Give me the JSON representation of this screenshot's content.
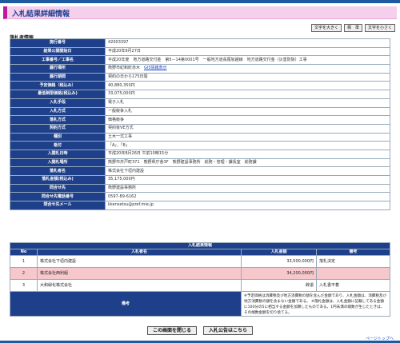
{
  "page": {
    "title": "入札結果詳細情報"
  },
  "font_size_buttons": {
    "large": "文字を大きく",
    "standard": "標　準",
    "small": "文字を小さく"
  },
  "section_label": "落札者情報",
  "info_rows": [
    {
      "label": "施行番号",
      "value": "42003397"
    },
    {
      "label": "結果公開開始日",
      "value": "平成20年9月27日"
    },
    {
      "label": "工事番号／工事名",
      "value": "平成20年度　地方道路交付金　第5－14第0001号　一般地方道長尾坂越線　地方道路交付金（災害防除）工事"
    },
    {
      "label": "履行場所",
      "value": "熊野市紀和町赤木",
      "link": "GIS情報表示"
    },
    {
      "label": "履行期間",
      "value": "契約の日から175日間"
    },
    {
      "label": "予定価格（税込み）",
      "value": "40,880,350円"
    },
    {
      "label": "最低制限価格(税込み)",
      "value": "33,075,000円"
    },
    {
      "label": "入札手段",
      "value": "電子入札"
    },
    {
      "label": "入札方式",
      "value": "一般競争入札"
    },
    {
      "label": "落札方式",
      "value": "価格競争"
    },
    {
      "label": "契約方式",
      "value": "契約後VE方式"
    },
    {
      "label": "種別",
      "value": "土木一式工事"
    },
    {
      "label": "格付",
      "value": "「A」、「B」"
    },
    {
      "label": "入開札日時",
      "value": "平成20年8月26日 午前10時15分"
    },
    {
      "label": "入開札場所",
      "value": "熊野市井戸町371　熊野県庁舎3F　熊野建設事務所　総務・管理・課長室　総務課"
    },
    {
      "label": "落札者名",
      "value": "株式会社下垣内建設"
    },
    {
      "label": "落札金額(税込み)",
      "value": "35,175,000円"
    },
    {
      "label": "問合せ先",
      "value": "熊野建設事務所"
    },
    {
      "label": "問合せ先電話番号",
      "value": "0597-89-6162"
    },
    {
      "label": "問合せ先メール",
      "value": "kkensetsu@pref.mie.jp"
    }
  ],
  "bids": {
    "caption": "入札結果情報",
    "headers": {
      "no": "No",
      "name": "入札者名",
      "amount": "入札金額",
      "note": "備考"
    },
    "rows": [
      {
        "no": "1",
        "name": "株式会社下垣内建設",
        "amount": "33,500,000円",
        "note": "落札決定",
        "highlight": false
      },
      {
        "no": "2",
        "name": "株式会社西利組",
        "amount": "34,200,000円",
        "note": "",
        "highlight": true
      },
      {
        "no": "3",
        "name": "大和緑化株式会社",
        "amount": "辞退",
        "note": "入札書不着",
        "highlight": false
      }
    ],
    "remarks_label": "備考",
    "remarks": "※予定価格は消費税及び地方消費税の額を含んだ金額であり、入札金額は、消費税及び地方消費税の額を含まない金額である。 ※落札金額は、入札金額に記載してある金額に100分の5に相当する金額を加算したものである。1円未満の端数が生じたときは、その端数金額を切り捨てる。"
  },
  "buttons": {
    "close": "この画面を閉じる",
    "notice": "入札公告はこちら"
  },
  "page_top_link": "ページトップへ",
  "colors": {
    "header_navy": "#1e3f8a",
    "title_pink": "#f4d0ec",
    "highlight_row": "#f6c8cc",
    "top_bar": "#1e5aa0"
  }
}
